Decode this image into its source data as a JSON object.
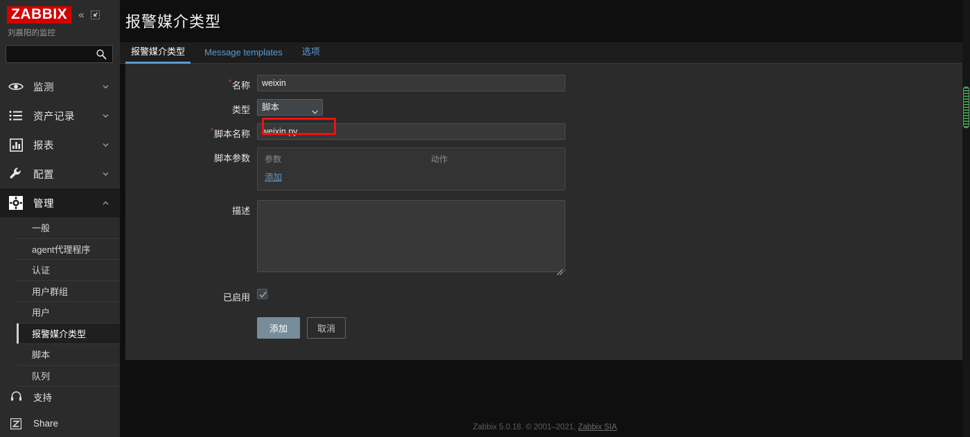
{
  "sidebar": {
    "logo": "ZABBIX",
    "subtitle": "刘晨阳的监控",
    "collapse_icon": "double-chevron-left-icon",
    "expand_icon": "collapse-arrow-icon",
    "search": {
      "value": "",
      "placeholder": ""
    },
    "nav": [
      {
        "label": "监测",
        "icon": "eye-icon",
        "expanded": false
      },
      {
        "label": "资产记录",
        "icon": "list-icon",
        "expanded": false
      },
      {
        "label": "报表",
        "icon": "bar-chart-icon",
        "expanded": false
      },
      {
        "label": "配置",
        "icon": "wrench-icon",
        "expanded": false
      },
      {
        "label": "管理",
        "icon": "gear-icon",
        "expanded": true
      }
    ],
    "submenu": [
      {
        "label": "一般"
      },
      {
        "label": "agent代理程序"
      },
      {
        "label": "认证"
      },
      {
        "label": "用户群组"
      },
      {
        "label": "用户"
      },
      {
        "label": "报警媒介类型"
      },
      {
        "label": "脚本"
      },
      {
        "label": "队列"
      }
    ],
    "bottom": [
      {
        "label": "支持",
        "icon": "headset-icon"
      },
      {
        "label": "Share",
        "icon": "zabbix-share-icon"
      }
    ]
  },
  "header": {
    "title": "报警媒介类型"
  },
  "tabs": [
    {
      "label": "报警媒介类型"
    },
    {
      "label": "Message templates"
    },
    {
      "label": "选项"
    }
  ],
  "form": {
    "name": {
      "label": "名称",
      "value": "weixin",
      "required": true
    },
    "type": {
      "label": "类型",
      "value": "脚本",
      "options": [
        "脚本"
      ]
    },
    "script_name": {
      "label": "脚本名称",
      "value": "weixin.py",
      "required": true
    },
    "script_params": {
      "label": "脚本参数",
      "col_param": "参数",
      "col_action": "动作",
      "add_link": "添加",
      "rows": []
    },
    "description": {
      "label": "描述",
      "value": ""
    },
    "enabled": {
      "label": "已启用",
      "checked": true
    },
    "submit_label": "添加",
    "cancel_label": "取消"
  },
  "footer": {
    "text": "Zabbix 5.0.18. © 2001–2021, ",
    "link": "Zabbix SIA"
  },
  "colors": {
    "brand_red": "#d40000",
    "accent_blue": "#5e9bd0",
    "annotation_red": "#f01010",
    "scrollbar_green": "#2f9e3f"
  }
}
